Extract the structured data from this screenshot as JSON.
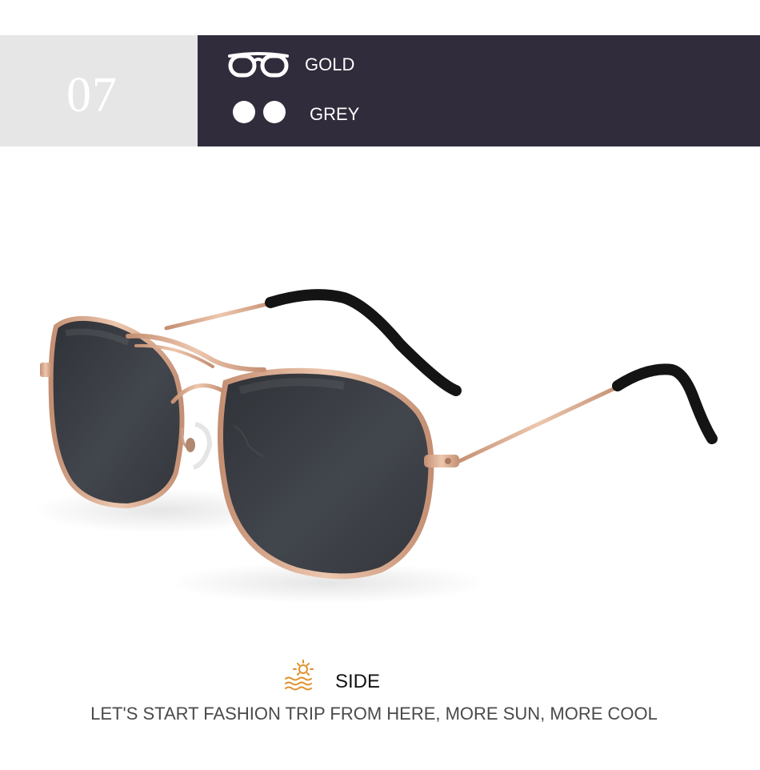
{
  "banner": {
    "number": "07",
    "options": [
      {
        "label": "GOLD",
        "icon": "frame-glasses-icon"
      },
      {
        "label": "GREY",
        "icon": "lens-circles-icon"
      }
    ],
    "colors": {
      "number_bg": "#e6e6e6",
      "options_bg": "#312c3b",
      "text": "#ffffff"
    }
  },
  "product": {
    "icon": "aviator-sunglasses-image",
    "frame_color": "#d7a98b",
    "lens_color": "#3b3e44"
  },
  "caption": {
    "title": "SIDE",
    "title_icon": "sun-over-water-icon",
    "tagline": "LET'S START FASHION TRIP FROM HERE, MORE SUN, MORE COOL",
    "icon_color": "#e0902a"
  }
}
